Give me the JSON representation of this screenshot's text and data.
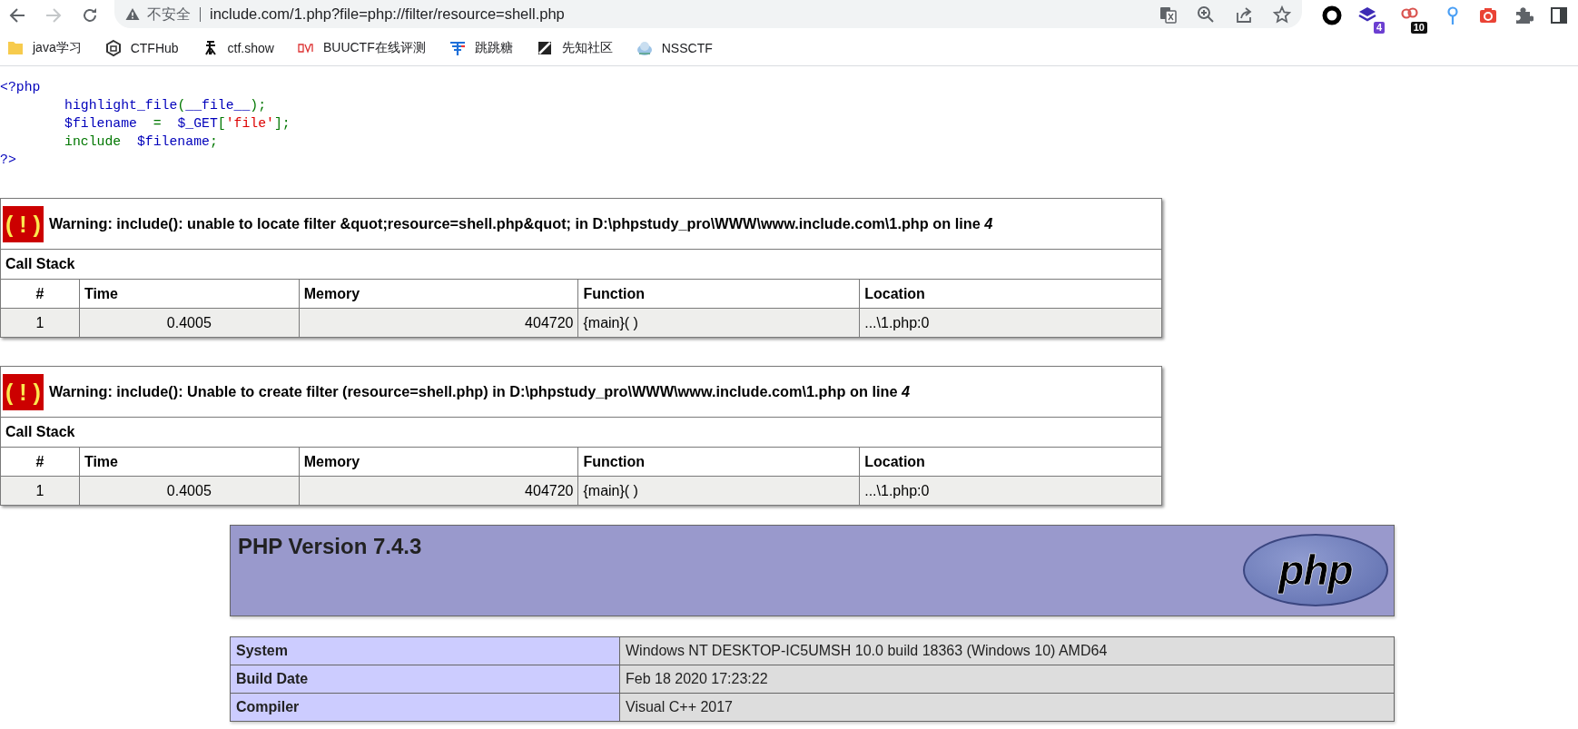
{
  "browser": {
    "nav_buttons": [
      {
        "kind": "back",
        "disabled": false
      },
      {
        "kind": "forward",
        "disabled": true
      },
      {
        "kind": "reload",
        "disabled": false
      }
    ],
    "address": {
      "security_label": "不安全",
      "url": "include.com/1.php?file=php://filter/resource=shell.php"
    },
    "address_actions": [
      {
        "kind": "translate"
      },
      {
        "kind": "zoom"
      },
      {
        "kind": "share"
      },
      {
        "kind": "star"
      }
    ],
    "extensions": [
      {
        "kind": "ring"
      },
      {
        "kind": "stack",
        "badge": "4"
      },
      {
        "kind": "link",
        "badge": "10"
      },
      {
        "kind": "pin"
      },
      {
        "kind": "camera"
      },
      {
        "kind": "puzzle"
      },
      {
        "kind": "sidebar"
      }
    ]
  },
  "bookmarks": [
    {
      "kind": "folder",
      "label": "java学习"
    },
    {
      "kind": "cube",
      "label": "CTFHub"
    },
    {
      "kind": "figure",
      "label": "ctf.show"
    },
    {
      "kind": "red-logo",
      "label": "BUUCTF在线评测"
    },
    {
      "kind": "blue-logo",
      "label": "跳跳糖"
    },
    {
      "kind": "slash",
      "label": "先知社区"
    },
    {
      "kind": "cloud",
      "label": "NSSCTF"
    }
  ],
  "source": {
    "lines": [
      [
        {
          "kind": "default",
          "text": "<?php"
        }
      ],
      [
        {
          "kind": "default",
          "text": "\thighlight_file"
        },
        {
          "kind": "keyword",
          "text": "("
        },
        {
          "kind": "default",
          "text": "__file__"
        },
        {
          "kind": "keyword",
          "text": ");"
        }
      ],
      [
        {
          "kind": "default",
          "text": "\t$filename"
        },
        {
          "kind": "keyword",
          "text": "  =  "
        },
        {
          "kind": "default",
          "text": "$_GET"
        },
        {
          "kind": "keyword",
          "text": "["
        },
        {
          "kind": "string",
          "text": "'file'"
        },
        {
          "kind": "keyword",
          "text": "];"
        }
      ],
      [
        {
          "kind": "keyword",
          "text": "\tinclude  "
        },
        {
          "kind": "default",
          "text": "$filename"
        },
        {
          "kind": "keyword",
          "text": ";"
        }
      ],
      [
        {
          "kind": "default",
          "text": "?>"
        }
      ]
    ]
  },
  "errors": [
    {
      "icon_text": "( ! )",
      "message": "Warning: include(): unable to locate filter &quot;resource=shell.php&quot; in D:\\phpstudy_pro\\WWW\\www.include.com\\1.php on line *4*",
      "call_stack_title": "Call Stack",
      "columns": [
        "#",
        "Time",
        "Memory",
        "Function",
        "Location"
      ],
      "rows": [
        [
          "1",
          "0.4005",
          "404720",
          "{main}( )",
          "...\\1.php:0"
        ]
      ]
    },
    {
      "icon_text": "( ! )",
      "message": "Warning: include(): Unable to create filter (resource=shell.php) in D:\\phpstudy_pro\\WWW\\www.include.com\\1.php on line *4*",
      "call_stack_title": "Call Stack",
      "columns": [
        "#",
        "Time",
        "Memory",
        "Function",
        "Location"
      ],
      "rows": [
        [
          "1",
          "0.4005",
          "404720",
          "{main}( )",
          "...\\1.php:0"
        ]
      ]
    }
  ],
  "phpinfo": {
    "title": "PHP Version 7.4.3",
    "logo": "php",
    "rows": [
      {
        "label": "System",
        "value": "Windows NT DESKTOP-IC5UMSH 10.0 build 18363 (Windows 10) AMD64"
      },
      {
        "label": "Build Date",
        "value": "Feb 18 2020 17:23:22"
      },
      {
        "label": "Compiler",
        "value": "Visual C++ 2017"
      }
    ]
  }
}
